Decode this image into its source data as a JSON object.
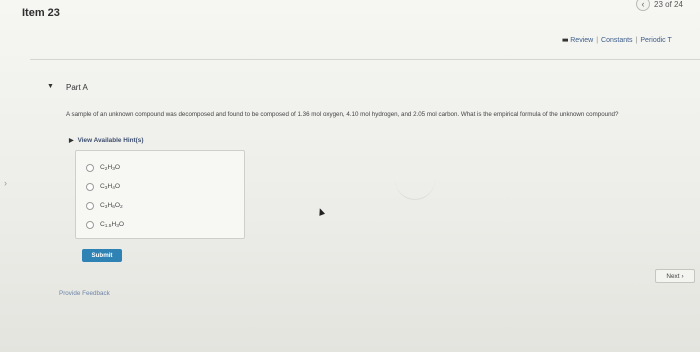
{
  "header": {
    "item_title": "Item 23",
    "counter": "23 of 24",
    "prev_glyph": "‹",
    "links": {
      "review": "Review",
      "sep1": "|",
      "constants": "Constants",
      "sep2": "|",
      "periodic": "Periodic T"
    }
  },
  "part": {
    "label": "Part A",
    "question": "A sample of an unknown compound was decomposed and found to be composed of 1.36 mol oxygen, 4.10 mol hydrogen, and 2.05 mol carbon. What is the empirical formula of the unknown compound?",
    "hints_label": "View Available Hint(s)"
  },
  "options": [
    {
      "base": "C",
      "s1": "2",
      "mid": "H",
      "s2": "3",
      "end": "O",
      "s3": ""
    },
    {
      "base": "C",
      "s1": "3",
      "mid": "H",
      "s2": "4",
      "end": "O",
      "s3": ""
    },
    {
      "base": "C",
      "s1": "3",
      "mid": "H",
      "s2": "6",
      "end": "O",
      "s3": "2"
    },
    {
      "base": "C",
      "s1": "1.5",
      "mid": "H",
      "s2": "3",
      "end": "O",
      "s3": ""
    }
  ],
  "buttons": {
    "submit": "Submit",
    "next": "Next",
    "next_glyph": "›"
  },
  "feedback": "Provide Feedback",
  "colors": {
    "submit_bg": "#2f82b4",
    "link": "#3e5d8a"
  }
}
